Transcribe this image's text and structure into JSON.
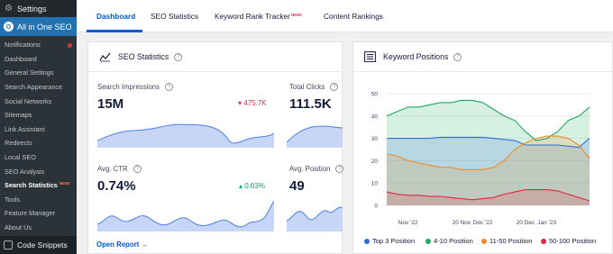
{
  "sidebar": {
    "settings_label": "Settings",
    "aioseo_label": "All in One SEO",
    "items": [
      {
        "label": "Notifications"
      },
      {
        "label": "Dashboard"
      },
      {
        "label": "General Settings"
      },
      {
        "label": "Search Appearance"
      },
      {
        "label": "Social Networks"
      },
      {
        "label": "Sitemaps"
      },
      {
        "label": "Link Assistant"
      },
      {
        "label": "Redirects"
      },
      {
        "label": "Local SEO"
      },
      {
        "label": "SEO Analysis"
      },
      {
        "label": "Search Statistics",
        "badge": "NEW!"
      },
      {
        "label": "Tools"
      },
      {
        "label": "Feature Manager"
      },
      {
        "label": "About Us"
      }
    ],
    "code_snippets_label": "Code Snippets"
  },
  "tabs": [
    {
      "label": "Dashboard"
    },
    {
      "label": "SEO Statistics"
    },
    {
      "label": "Keyword Rank Tracker",
      "badge": "NEW!"
    },
    {
      "label": "Content Rankings"
    }
  ],
  "seo_card": {
    "title": "SEO Statistics",
    "stats": [
      {
        "label": "Search Impressions",
        "value": "15M",
        "change": "475.7K",
        "direction": "down"
      },
      {
        "label": "Total Clicks",
        "value": "111.5K"
      },
      {
        "label": "Avg. CTR",
        "value": "0.74%",
        "change": "0.03%",
        "direction": "up"
      },
      {
        "label": "Avg. Position",
        "value": "49"
      }
    ],
    "open_report": "Open Report →"
  },
  "keyword_card": {
    "title": "Keyword Positions"
  },
  "chart_data": {
    "type": "area",
    "stacked": true,
    "x_tick_labels": [
      "Nov '22",
      "20 Nov",
      "Dec '22",
      "20 Dec",
      "Jan '23"
    ],
    "y_ticks": [
      0,
      10,
      20,
      30,
      40,
      50
    ],
    "ylim": [
      0,
      50
    ],
    "grid": true,
    "legend_position": "bottom",
    "points": 20,
    "series": [
      {
        "name": "Top 3 Position",
        "color": "#2f6fdb",
        "values": [
          30,
          30,
          30,
          30,
          30,
          30.5,
          30.5,
          30.5,
          30.5,
          30.5,
          30,
          29.5,
          29,
          27,
          27,
          27,
          27,
          26.5,
          26,
          30
        ]
      },
      {
        "name": "4-10 Position",
        "color": "#1eaa5f",
        "values": [
          40,
          42,
          44,
          44,
          45,
          46,
          46,
          47,
          47,
          46,
          43,
          40,
          38,
          33,
          29,
          30,
          33,
          38,
          40,
          44
        ]
      },
      {
        "name": "11-50 Position",
        "color": "#f08a24",
        "values": [
          23,
          22,
          20,
          19,
          18,
          17,
          17,
          16,
          16,
          16,
          17,
          20,
          25,
          28,
          30,
          31,
          31,
          30,
          27,
          21
        ]
      },
      {
        "name": "50-100 Position",
        "color": "#df2a4a",
        "values": [
          6,
          5,
          4.5,
          4.5,
          4,
          4,
          3.5,
          3,
          2.5,
          3,
          3.5,
          5,
          6,
          7,
          7,
          7,
          6.5,
          5,
          3.5,
          2
        ]
      }
    ]
  },
  "colors": {
    "accent": "#005ae0",
    "sidebar_active": "#2271b1",
    "sparkline_stroke": "#4d80e4",
    "sparkline_fill": "#c7d6f7"
  }
}
